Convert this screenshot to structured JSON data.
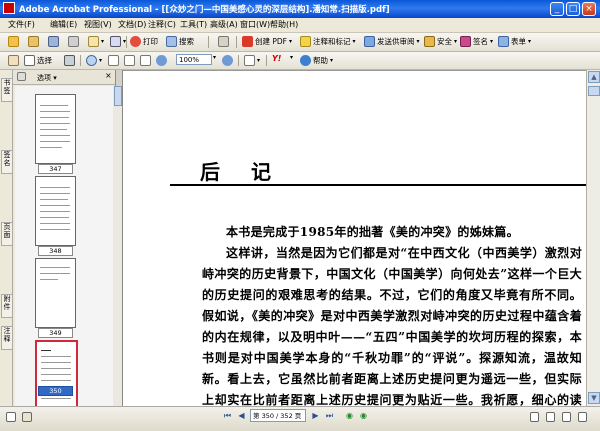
{
  "window": {
    "title": "Adobe Acrobat Professional - [[众妙之门—中国美感心灵的深层结构].潘知常.扫描版.pdf]"
  },
  "menu": [
    "文件(F)",
    "编辑(E)",
    "视图(V)",
    "文档(D)",
    "注释(C)",
    "工具(T)",
    "高级(A)",
    "窗口(W)",
    "帮助(H)"
  ],
  "toolbar1": {
    "acrobat_label": "创建 PDF",
    "review_label": "注释和标记",
    "send_label": "发送供审阅",
    "secure_label": "安全",
    "sign_label": "签名",
    "form_label": "表单",
    "print_label": "打印",
    "search_label": "搜索"
  },
  "toolbar2": {
    "select_label": "选择",
    "zoom_value": "100%",
    "help_label": "帮助"
  },
  "sidebar": {
    "tabs": [
      "书签",
      "签名",
      "页面",
      "附件",
      "注释"
    ],
    "options_label": "选项",
    "thumbnails": [
      {
        "page": "347",
        "selected": false
      },
      {
        "page": "348",
        "selected": false
      },
      {
        "page": "349",
        "selected": false
      },
      {
        "page": "350",
        "selected": true
      }
    ]
  },
  "document": {
    "heading": "后 记",
    "paragraphs": [
      "本书是完成于1985年的拙著《美的冲突》的姊妹篇。",
      "这样讲，当然是因为它们都是对“在中西文化（中西美学）激烈对峙冲突的历史背景下，中国文化（中国美学）向何处去”这样一个巨大的历史提问的艰难思考的结果。不过，它们的角度又毕竟有所不同。假如说，《美的冲突》是对中西美学激烈对峙冲突的历史过程中蕴含着的内在规律，以及明中叶——“五四”中国美学的坎坷历程的探索，本书则是对中国美学本身的“千秋功罪”的“评说”。探源知流，温故知新。看上去，它虽然比前者距离上述历史提问更为遥远一些，但实际上却实在比前者距离上述历史提问更为贴近一些。我祈愿，细心的读者在考察全书后"
    ]
  },
  "status": {
    "page_indicator": "第 350 / 352 页"
  }
}
